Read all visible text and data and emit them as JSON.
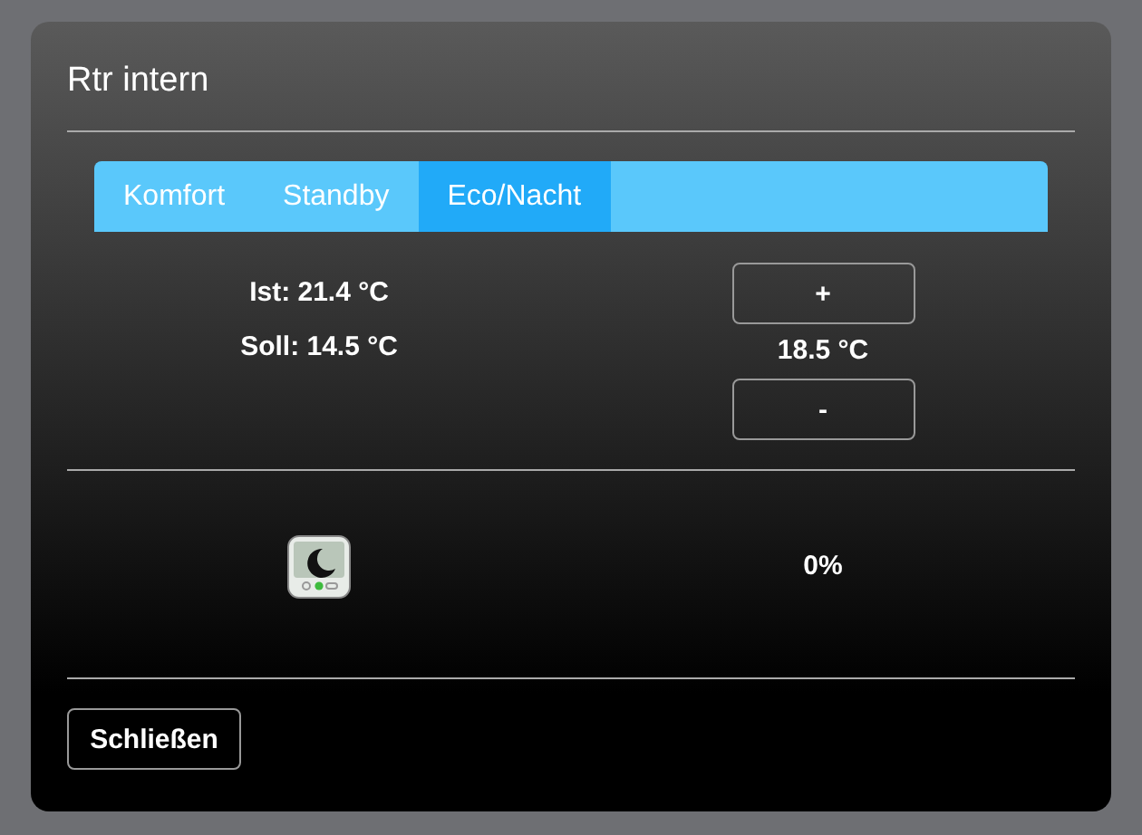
{
  "dialog": {
    "title": "Rtr intern"
  },
  "tabs": [
    {
      "label": "Komfort",
      "selected": false
    },
    {
      "label": "Standby",
      "selected": false
    },
    {
      "label": "Eco/Nacht",
      "selected": true
    }
  ],
  "readings": {
    "actual": "Ist: 21.4 °C",
    "setpoint": "Soll: 14.5 °C"
  },
  "adjust": {
    "increase": "+",
    "value": "18.5 °C",
    "decrease": "-"
  },
  "mode": {
    "output": "0%"
  },
  "buttons": [
    "Schließen"
  ]
}
